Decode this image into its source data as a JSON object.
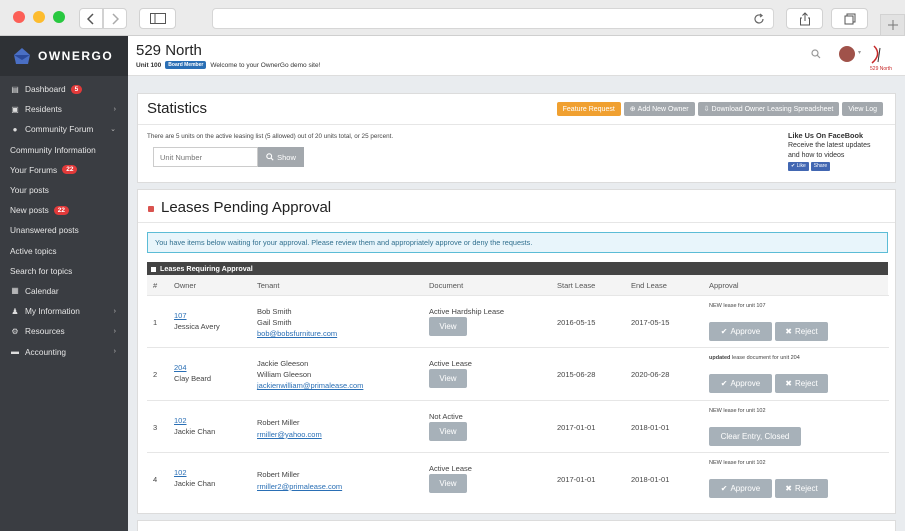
{
  "brand": {
    "name": "OWNERGO"
  },
  "header": {
    "title": "529 North",
    "unit": "Unit 100",
    "role_badge": "Board Member",
    "welcome": "Welcome to your OwnerGo demo site!",
    "logo_text": "529 North"
  },
  "sidebar": {
    "items": [
      {
        "label": "Dashboard",
        "icon": "dashboard-icon",
        "badge": "5"
      },
      {
        "label": "Residents",
        "icon": "residents-icon",
        "caret": "›"
      },
      {
        "label": "Community Forum",
        "icon": "forum-icon",
        "caret": "⌄"
      },
      {
        "label": "Community Information"
      },
      {
        "label": "Your Forums",
        "badge": "22"
      },
      {
        "label": "Your posts"
      },
      {
        "label": "New posts",
        "badge": "22"
      },
      {
        "label": "Unanswered posts"
      },
      {
        "label": "Active topics"
      },
      {
        "label": "Search for topics"
      },
      {
        "label": "Calendar",
        "icon": "calendar-icon"
      },
      {
        "label": "My Information",
        "icon": "user-icon",
        "caret": "›"
      },
      {
        "label": "Resources",
        "icon": "resources-icon",
        "caret": "›"
      },
      {
        "label": "Accounting",
        "icon": "accounting-icon",
        "caret": "›"
      }
    ]
  },
  "stats": {
    "title": "Statistics",
    "btn_feature": "Feature Request",
    "btn_add_owner": "Add New Owner",
    "btn_download": "Download Owner Leasing Spreadsheet",
    "btn_viewlog": "View Log",
    "summary": "There are 5 units on the active leasing list (5 allowed) out of 20 units total, or 25 percent.",
    "unit_placeholder": "Unit Number",
    "show_btn": "Show",
    "fb_title": "Like Us On FaceBook",
    "fb_text1": "Receive the latest updates",
    "fb_text2": "and how to videos",
    "fb_like": "Like",
    "fb_share": "Share"
  },
  "leases": {
    "title": "Leases Pending Approval",
    "notice": "You have items below waiting for your approval. Please review them and appropriately approve or deny the requests.",
    "table_title": "Leases Requiring Approval",
    "columns": [
      "#",
      "Owner",
      "Tenant",
      "Document",
      "Start Lease",
      "End Lease",
      "Approval"
    ],
    "rows": [
      {
        "num": "1",
        "unit": "107",
        "owner": "Jessica Avery",
        "tenant1": "Bob Smith",
        "tenant2": "Gail Smith",
        "email": "bob@bobsfurniture.com",
        "doc": "Active Hardship Lease",
        "view": "View",
        "start": "2016-05-15",
        "end": "2017-05-15",
        "note_strong": "",
        "note": "NEW lease for unit 107",
        "approve": "Approve",
        "reject": "Reject"
      },
      {
        "num": "2",
        "unit": "204",
        "owner": "Clay Beard",
        "tenant1": "Jackie Gleeson",
        "tenant2": "William Gleeson",
        "email": "jackienwilliam@primalease.com",
        "doc": "Active Lease",
        "view": "View",
        "start": "2015-06-28",
        "end": "2020-06-28",
        "note_strong": "updated",
        "note": " lease document for unit 204",
        "approve": "Approve",
        "reject": "Reject"
      },
      {
        "num": "3",
        "unit": "102",
        "owner": "Jackie Chan",
        "tenant1": "Robert Miller",
        "tenant2": "",
        "email": "rmiller@yahoo.com",
        "doc": "Not Active",
        "view": "View",
        "start": "2017-01-01",
        "end": "2018-01-01",
        "note_strong": "",
        "note": "NEW lease for unit 102",
        "clear": "Clear Entry, Closed"
      },
      {
        "num": "4",
        "unit": "102",
        "owner": "Jackie Chan",
        "tenant1": "Robert Miller",
        "tenant2": "",
        "email": "rmiller2@primalease.com",
        "doc": "Active Lease",
        "view": "View",
        "start": "2017-01-01",
        "end": "2018-01-01",
        "note_strong": "",
        "note": "NEW lease for unit 102",
        "approve": "Approve",
        "reject": "Reject"
      }
    ]
  },
  "colors": {
    "sidebar": "#3a3d42",
    "accent": "#f0a030",
    "badge": "#e23a3a",
    "link": "#2a6fb5"
  }
}
